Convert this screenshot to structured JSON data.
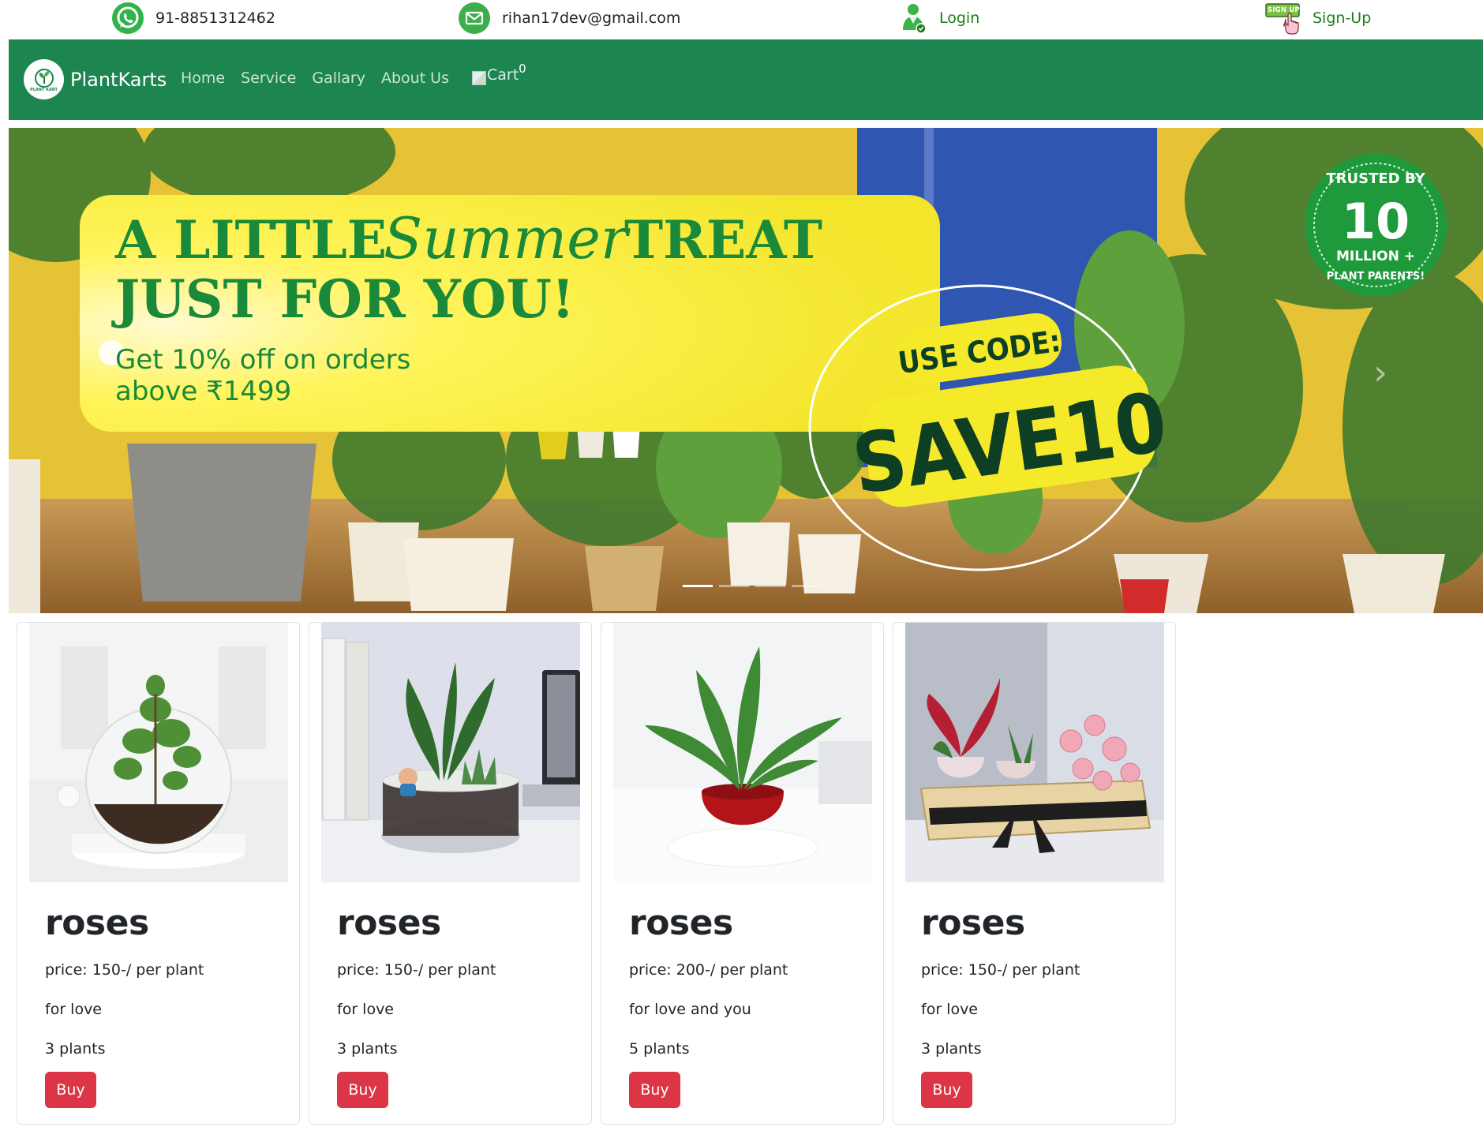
{
  "topbar": {
    "phone": {
      "text": "91-8851312462",
      "icon": "whatsapp-icon",
      "icon_color": "#2fb34a"
    },
    "email": {
      "text": "rihan17dev@gmail.com",
      "icon": "mail-icon",
      "icon_color": "#3cae4a"
    },
    "login": {
      "text": "Login",
      "icon": "user-icon",
      "color": "#1b7f1b"
    },
    "signup": {
      "text": "Sign-Up",
      "icon": "signup-badge-icon",
      "badge_text": "SIGN UP",
      "color": "#1b7f1b"
    }
  },
  "navbar": {
    "background": "#1c8550",
    "brand": {
      "name": "PlantKarts",
      "logo_text": "PLANT KART"
    },
    "links": [
      "Home",
      "Service",
      "Gallary",
      "About Us"
    ],
    "cart": {
      "label": "Cart",
      "count": "0"
    }
  },
  "banner": {
    "headline_line1_part1": "A LITTLE",
    "headline_line1_script": "Summer",
    "headline_line1_part2": "TREAT",
    "headline_line2": "JUST FOR YOU!",
    "offer_line1": "Get 10% off on orders",
    "offer_line2": "above ₹1499",
    "code_label": "USE CODE:",
    "code_value": "SAVE10",
    "badge_top": "TRUSTED BY",
    "badge_number": "10",
    "badge_middle": "MILLION +",
    "badge_bottom": "PLANT PARENTS!",
    "slide_count": 4,
    "active_slide": 1
  },
  "products": [
    {
      "title": "roses",
      "price": "price: 150-/ per plant",
      "desc": "for love",
      "qty": "3 plants",
      "button": "Buy",
      "image": "jade-terrarium-image"
    },
    {
      "title": "roses",
      "price": "price: 150-/ per plant",
      "desc": "for love",
      "qty": "3 plants",
      "button": "Buy",
      "image": "zz-plant-terrarium-image"
    },
    {
      "title": "roses",
      "price": "price: 200-/ per plant",
      "desc": "for love and you",
      "qty": "5 plants",
      "button": "Buy",
      "image": "peace-lily-red-pot-image"
    },
    {
      "title": "roses",
      "price": "price: 150-/ per plant",
      "desc": "for love",
      "qty": "3 plants",
      "button": "Buy",
      "image": "aglaonema-roses-gift-box-image"
    }
  ]
}
